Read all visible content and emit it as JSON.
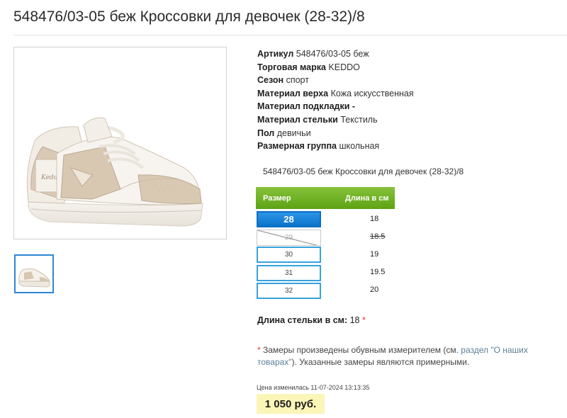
{
  "page": {
    "title": "548476/03-05 беж Кроссовки для девочек (28-32)/8"
  },
  "specs": [
    {
      "label": "Артикул",
      "value": "548476/03-05 беж"
    },
    {
      "label": "Торговая марка",
      "value": "KEDDO"
    },
    {
      "label": "Сезон",
      "value": "спорт"
    },
    {
      "label": "Материал верха",
      "value": "Кожа искусственная"
    },
    {
      "label": "Материал подкладки",
      "value": "-"
    },
    {
      "label": "Материал стельки",
      "value": "Текстиль"
    },
    {
      "label": "Пол",
      "value": "девичьи"
    },
    {
      "label": "Размерная группа",
      "value": "школьная"
    }
  ],
  "product_line": "548476/03-05 беж Кроссовки для девочек (28-32)/8",
  "size_table": {
    "col_size": "Размер",
    "col_length": "Длина в см",
    "rows": [
      {
        "size": "28",
        "length": "18",
        "state": "selected"
      },
      {
        "size": "29",
        "length": "18.5",
        "state": "unavailable"
      },
      {
        "size": "30",
        "length": "19",
        "state": "available"
      },
      {
        "size": "31",
        "length": "19.5",
        "state": "available"
      },
      {
        "size": "32",
        "length": "20",
        "state": "available"
      }
    ]
  },
  "insole": {
    "label": "Длина стельки в см:",
    "value": "18",
    "marker": "*"
  },
  "note": {
    "star": "*",
    "text_before": " Замеры произведены обувным измерителем (см. ",
    "link": "раздел \"О наших товарах\"",
    "text_after": "). Указанные замеры являются примерными."
  },
  "price": {
    "changed_label": "Цена изменилась 11-07-2024 13:13:35",
    "value": "1 050 руб."
  },
  "images": {
    "main_logo_text": "Kedde",
    "thumb_count": 1
  },
  "colors": {
    "accent_green": "#6db322",
    "accent_blue": "#1382d8",
    "price_bg": "#fbf5b7",
    "asterisk": "#e33"
  }
}
